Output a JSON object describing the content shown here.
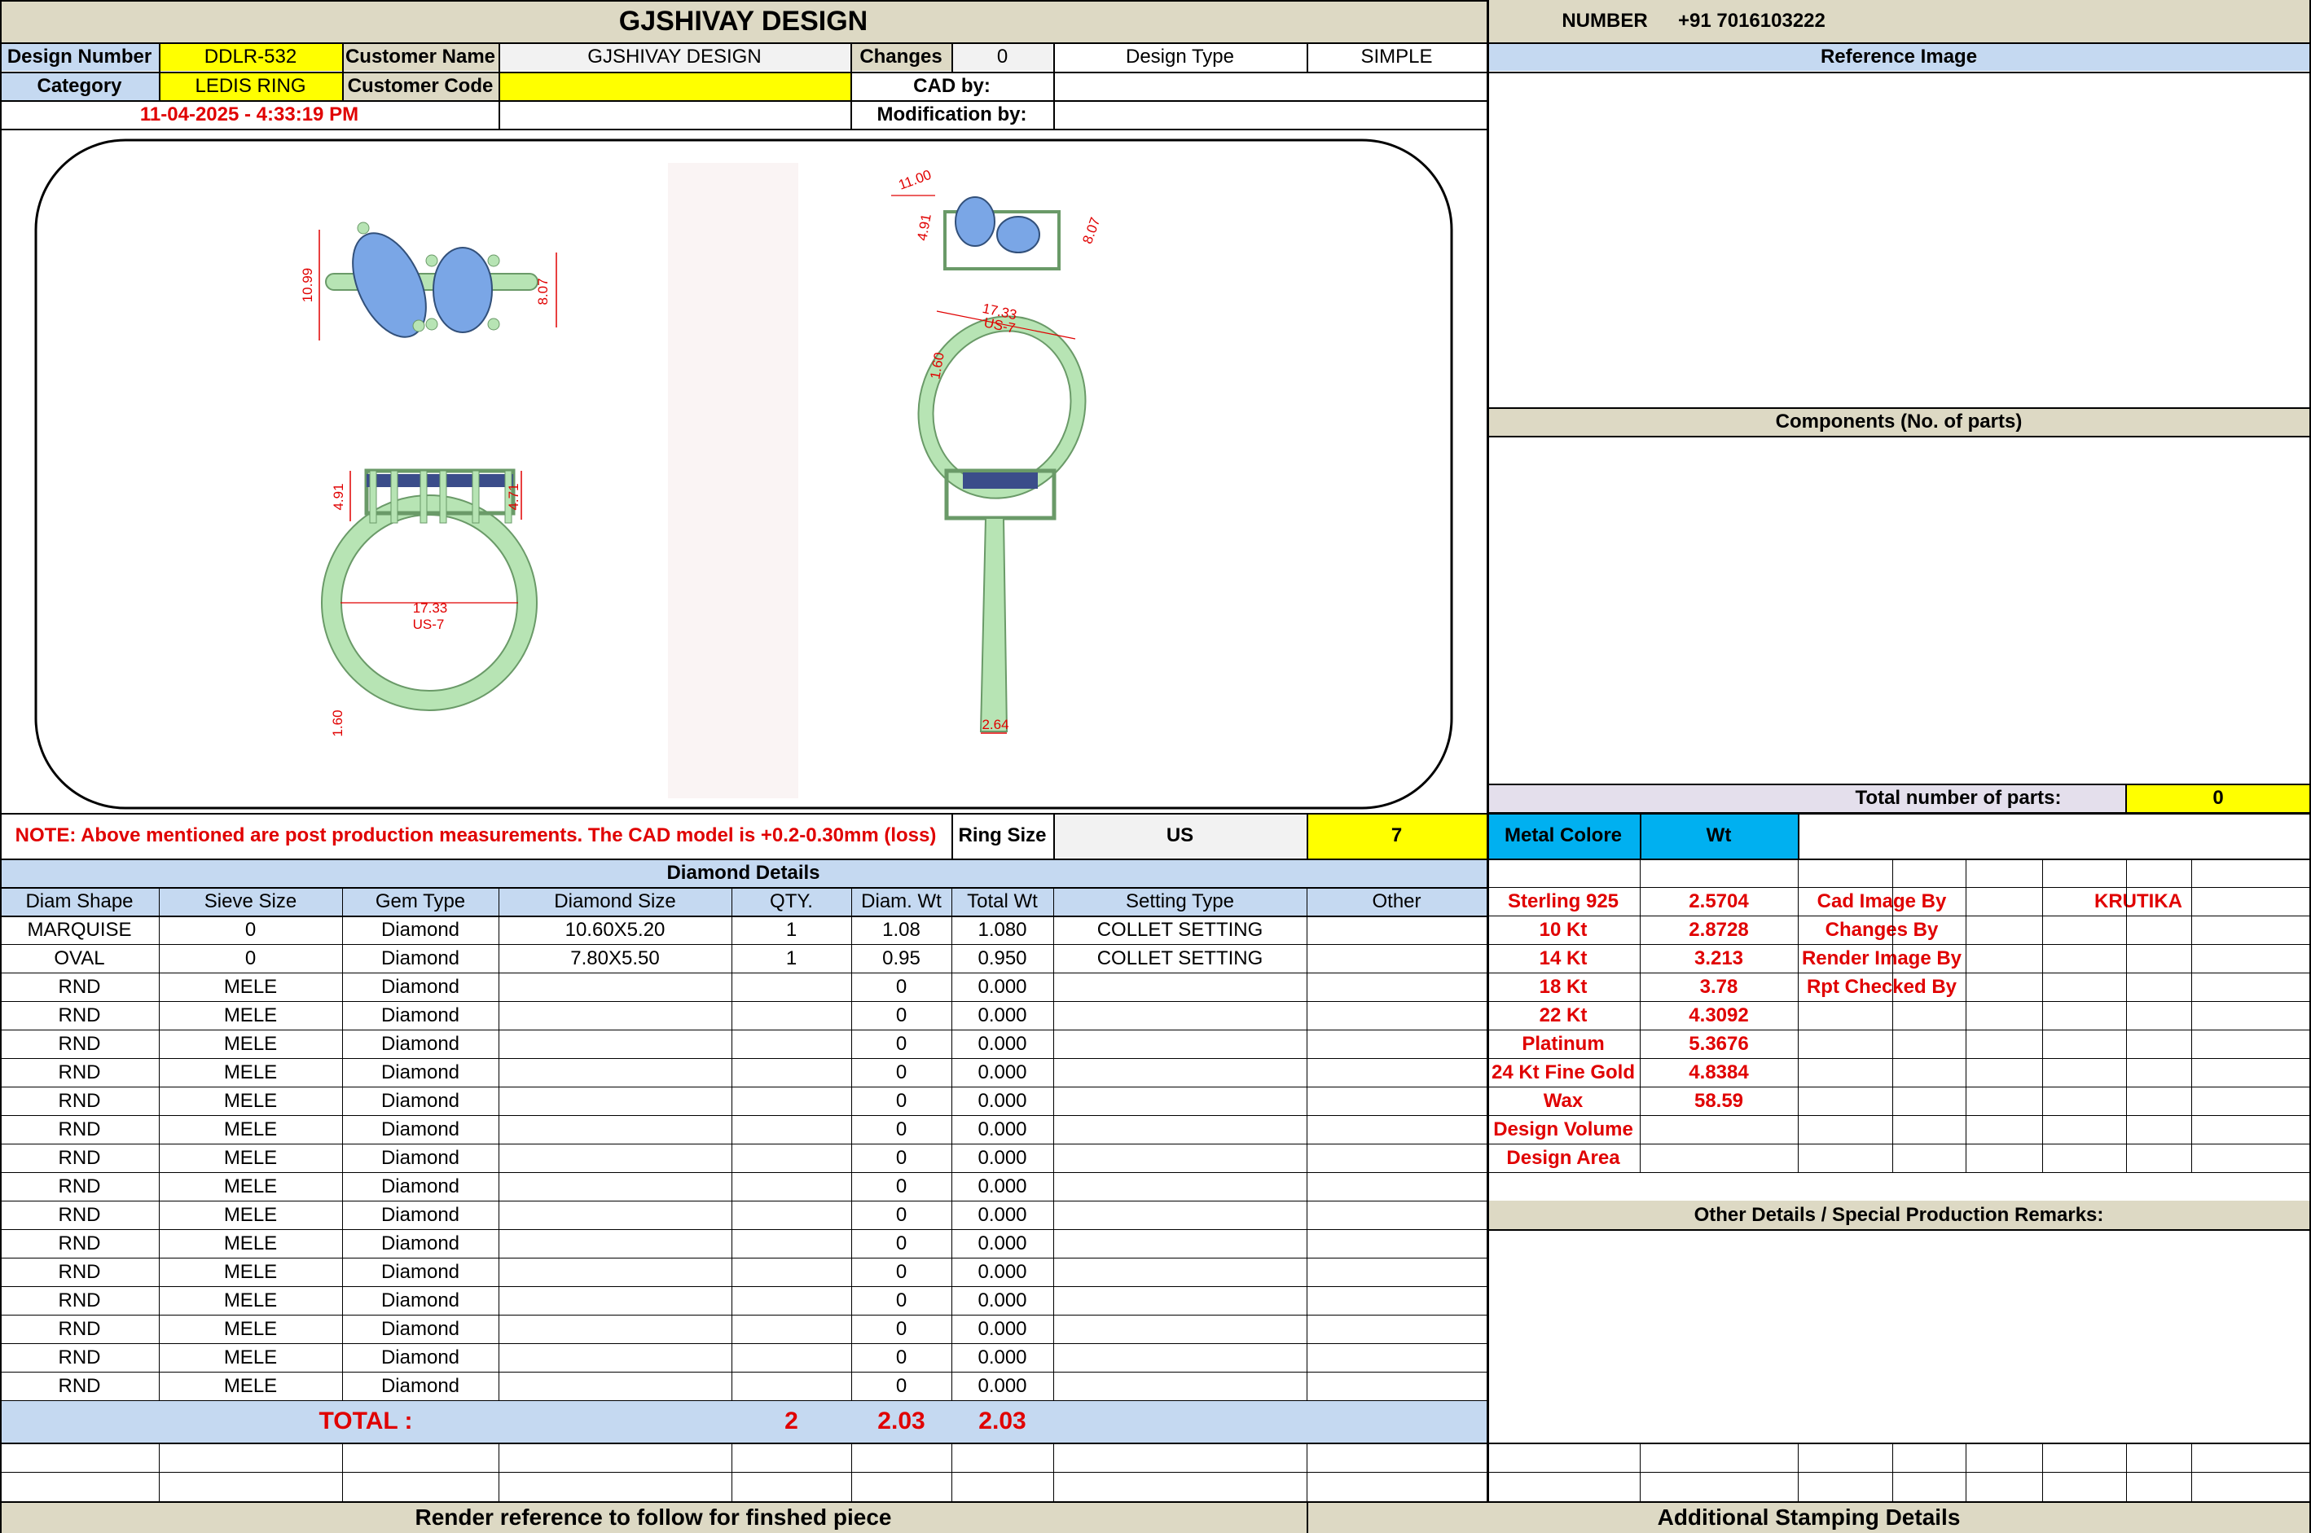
{
  "header": {
    "title": "GJSHIVAY DESIGN",
    "number_label": "NUMBER",
    "number_value": "+91 7016103222"
  },
  "info": {
    "design_number_label": "Design Number",
    "design_number": "DDLR-532",
    "customer_name_label": "Customer Name",
    "customer_name": "GJSHIVAY DESIGN",
    "changes_label": "Changes",
    "changes": "0",
    "design_type_label": "Design Type",
    "design_type": "SIMPLE",
    "category_label": "Category",
    "category": "LEDIS RING",
    "customer_code_label": "Customer Code",
    "customer_code": "",
    "cad_by_label": "CAD by:",
    "cad_by": "",
    "date": "11-04-2025 - 4:33:19 PM",
    "modification_by_label": "Modification by:",
    "modification_by": ""
  },
  "drawing": {
    "dims": {
      "top_height": "10.99",
      "top_right": "8.07",
      "persp_a": "11.00",
      "persp_b": "4.91",
      "persp_c": "8.07",
      "persp_d": "17.33",
      "persp_e": "US-7",
      "persp_f": "1.60",
      "front_left": "4.91",
      "front_right": "4.71",
      "front_inner": "17.33",
      "front_size": "US-7",
      "front_bottom": "1.60",
      "side_bottom": "2.64"
    }
  },
  "right_panel": {
    "reference_image": "Reference Image",
    "components": "Components (No. of parts)",
    "total_parts_label": "Total number of parts:",
    "total_parts": "0"
  },
  "note": {
    "text": "NOTE: Above mentioned are post production measurements. The CAD model is +0.2-0.30mm (loss)",
    "ring_size_label": "Ring Size",
    "ring_size_unit": "US",
    "ring_size": "7"
  },
  "diamonds": {
    "title": "Diamond Details",
    "headers": [
      "Diam Shape",
      "Sieve Size",
      "Gem Type",
      "Diamond Size",
      "QTY.",
      "Diam. Wt",
      "Total Wt",
      "Setting Type",
      "Other"
    ],
    "rows": [
      [
        "MARQUISE",
        "0",
        "Diamond",
        "10.60X5.20",
        "1",
        "1.08",
        "1.080",
        "COLLET SETTING",
        ""
      ],
      [
        "OVAL",
        "0",
        "Diamond",
        "7.80X5.50",
        "1",
        "0.95",
        "0.950",
        "COLLET SETTING",
        ""
      ],
      [
        "RND",
        "MELE",
        "Diamond",
        "",
        "",
        "0",
        "0.000",
        "",
        ""
      ],
      [
        "RND",
        "MELE",
        "Diamond",
        "",
        "",
        "0",
        "0.000",
        "",
        ""
      ],
      [
        "RND",
        "MELE",
        "Diamond",
        "",
        "",
        "0",
        "0.000",
        "",
        ""
      ],
      [
        "RND",
        "MELE",
        "Diamond",
        "",
        "",
        "0",
        "0.000",
        "",
        ""
      ],
      [
        "RND",
        "MELE",
        "Diamond",
        "",
        "",
        "0",
        "0.000",
        "",
        ""
      ],
      [
        "RND",
        "MELE",
        "Diamond",
        "",
        "",
        "0",
        "0.000",
        "",
        ""
      ],
      [
        "RND",
        "MELE",
        "Diamond",
        "",
        "",
        "0",
        "0.000",
        "",
        ""
      ],
      [
        "RND",
        "MELE",
        "Diamond",
        "",
        "",
        "0",
        "0.000",
        "",
        ""
      ],
      [
        "RND",
        "MELE",
        "Diamond",
        "",
        "",
        "0",
        "0.000",
        "",
        ""
      ],
      [
        "RND",
        "MELE",
        "Diamond",
        "",
        "",
        "0",
        "0.000",
        "",
        ""
      ],
      [
        "RND",
        "MELE",
        "Diamond",
        "",
        "",
        "0",
        "0.000",
        "",
        ""
      ],
      [
        "RND",
        "MELE",
        "Diamond",
        "",
        "",
        "0",
        "0.000",
        "",
        ""
      ],
      [
        "RND",
        "MELE",
        "Diamond",
        "",
        "",
        "0",
        "0.000",
        "",
        ""
      ],
      [
        "RND",
        "MELE",
        "Diamond",
        "",
        "",
        "0",
        "0.000",
        "",
        ""
      ],
      [
        "RND",
        "MELE",
        "Diamond",
        "",
        "",
        "0",
        "0.000",
        "",
        ""
      ]
    ],
    "total_label": "TOTAL :",
    "total_qty": "2",
    "total_diam_wt": "2.03",
    "total_wt": "2.03"
  },
  "metal": {
    "header_label": "Metal Colore",
    "header_wt": "Wt",
    "rows": [
      [
        "Sterling 925",
        "2.5704"
      ],
      [
        "10 Kt",
        "2.8728"
      ],
      [
        "14 Kt",
        "3.213"
      ],
      [
        "18 Kt",
        "3.78"
      ],
      [
        "22 Kt",
        "4.3092"
      ],
      [
        "Platinum",
        "5.3676"
      ],
      [
        "24 Kt Fine Gold",
        "4.8384"
      ],
      [
        "Wax",
        "58.59"
      ],
      [
        "Design Volume",
        ""
      ],
      [
        "Design Area",
        ""
      ]
    ]
  },
  "credits": {
    "rows": [
      [
        "Cad Image By",
        "KRUTIKA"
      ],
      [
        "Changes By",
        ""
      ],
      [
        "Render Image By",
        ""
      ],
      [
        "Rpt Checked By",
        ""
      ]
    ]
  },
  "other_details": "Other Details / Special Production Remarks:",
  "footer": {
    "render_reference": "Render reference to follow for finshed piece",
    "stamping": "Additional Stamping Details"
  }
}
